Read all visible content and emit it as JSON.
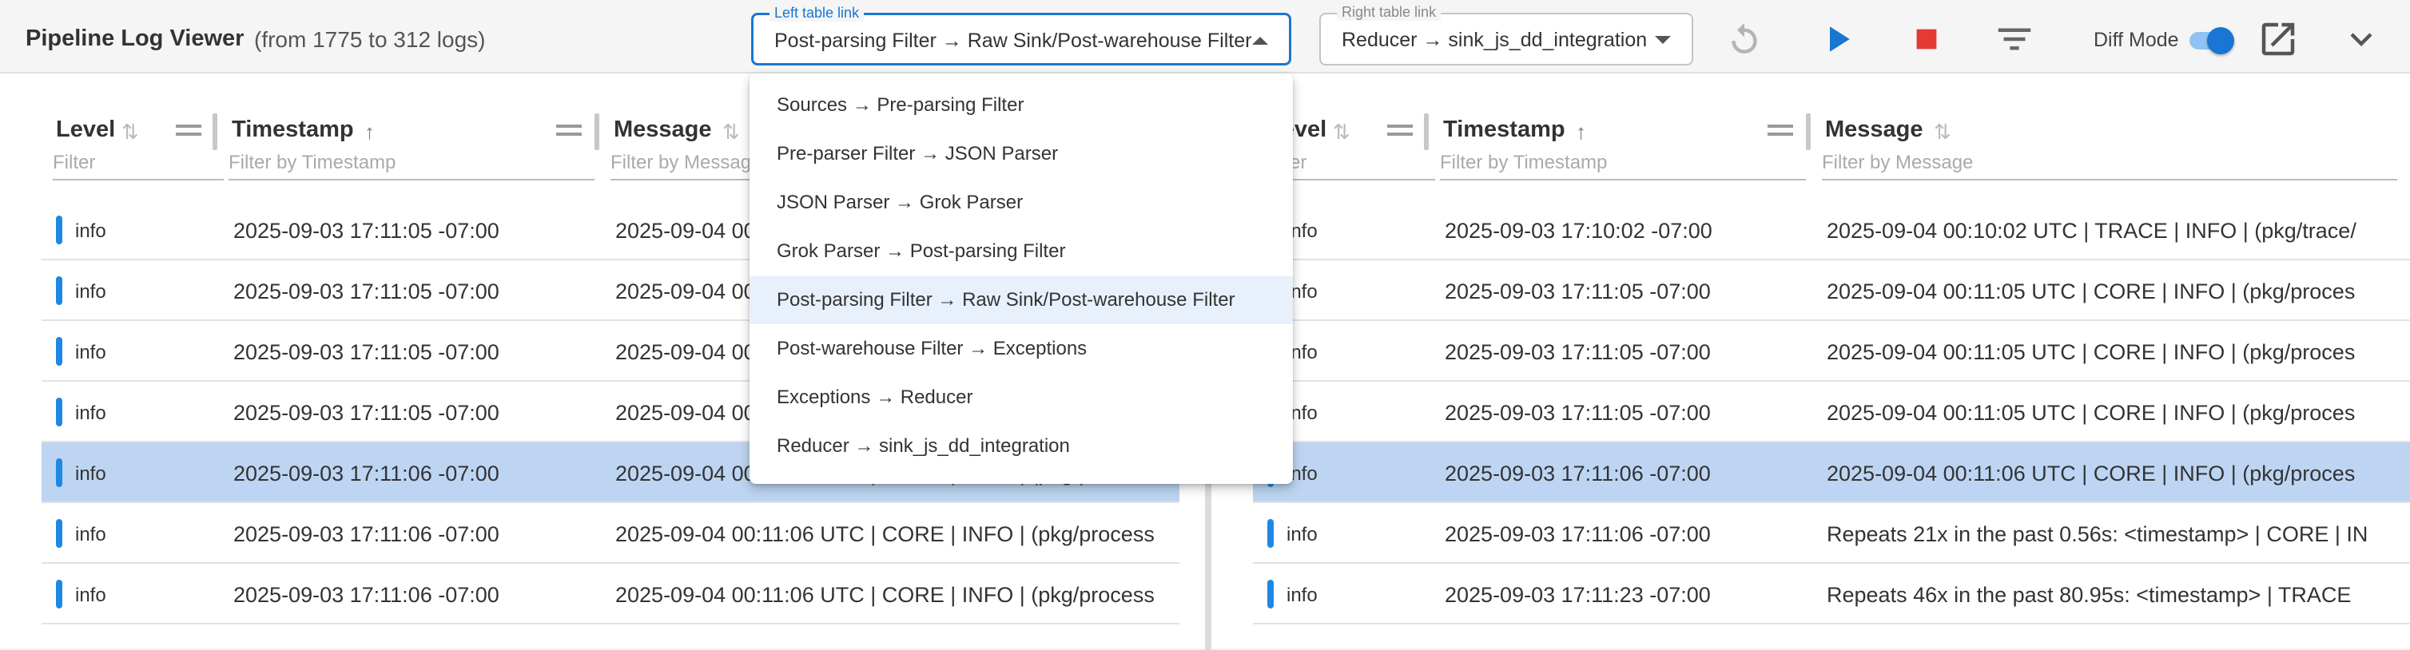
{
  "header": {
    "title": "Pipeline Log Viewer",
    "subtitle": "(from 1775 to 312 logs)",
    "left_select": {
      "legend": "Left table link",
      "value": "Post-parsing Filter → Raw Sink/Post-warehouse Filter"
    },
    "right_select": {
      "legend": "Right table link",
      "value": "Reducer → sink_js_dd_integration"
    },
    "diff_mode_label": "Diff Mode",
    "diff_mode_on": true,
    "icons": [
      "refresh-icon",
      "play-icon",
      "stop-icon",
      "filter-icon",
      "open-external-icon",
      "chevron-down-icon"
    ],
    "colors": {
      "accent": "#1976d2",
      "stop": "#e53935",
      "selected_row": "#bdd5f2",
      "level_bar": "#1e88e5"
    }
  },
  "left_table": {
    "columns": [
      {
        "label": "Level",
        "filter_placeholder": "Filter"
      },
      {
        "label": "Timestamp",
        "filter_placeholder": "Filter by Timestamp"
      },
      {
        "label": "Message",
        "filter_placeholder": "Filter by Message"
      }
    ],
    "rows": [
      {
        "level": "info",
        "timestamp": "2025-09-03 17:11:05 -07:00",
        "message": "2025-09-04 00:11:05 UTC | CORE | INFO | (pkg/process"
      },
      {
        "level": "info",
        "timestamp": "2025-09-03 17:11:05 -07:00",
        "message": "2025-09-04 00:11:05 UTC | CORE | INFO | (pkg/process"
      },
      {
        "level": "info",
        "timestamp": "2025-09-03 17:11:05 -07:00",
        "message": "2025-09-04 00:11:05 UTC | CORE | INFO | (pkg/process"
      },
      {
        "level": "info",
        "timestamp": "2025-09-03 17:11:05 -07:00",
        "message": "2025-09-04 00:11:05 UTC | CORE | INFO | (pkg/process"
      },
      {
        "level": "info",
        "timestamp": "2025-09-03 17:11:06 -07:00",
        "message": "2025-09-04 00:11:06 UTC | CORE | INFO | (pkg/process"
      },
      {
        "level": "info",
        "timestamp": "2025-09-03 17:11:06 -07:00",
        "message": "2025-09-04 00:11:06 UTC | CORE | INFO | (pkg/process"
      },
      {
        "level": "info",
        "timestamp": "2025-09-03 17:11:06 -07:00",
        "message": "2025-09-04 00:11:06 UTC | CORE | INFO | (pkg/process"
      }
    ]
  },
  "right_table": {
    "columns": [
      {
        "label": "Level",
        "filter_placeholder": "Filter"
      },
      {
        "label": "Timestamp",
        "filter_placeholder": "Filter by Timestamp"
      },
      {
        "label": "Message",
        "filter_placeholder": "Filter by Message"
      }
    ],
    "rows": [
      {
        "level": "info",
        "timestamp": "2025-09-03 17:10:02 -07:00",
        "message": "2025-09-04 00:10:02 UTC | TRACE | INFO | (pkg/trace/"
      },
      {
        "level": "info",
        "timestamp": "2025-09-03 17:11:05 -07:00",
        "message": "2025-09-04 00:11:05 UTC | CORE | INFO | (pkg/proces"
      },
      {
        "level": "info",
        "timestamp": "2025-09-03 17:11:05 -07:00",
        "message": "2025-09-04 00:11:05 UTC | CORE | INFO | (pkg/proces"
      },
      {
        "level": "info",
        "timestamp": "2025-09-03 17:11:05 -07:00",
        "message": "2025-09-04 00:11:05 UTC | CORE | INFO | (pkg/proces"
      },
      {
        "level": "info",
        "timestamp": "2025-09-03 17:11:06 -07:00",
        "message": "2025-09-04 00:11:06 UTC | CORE | INFO | (pkg/proces"
      },
      {
        "level": "info",
        "timestamp": "2025-09-03 17:11:06 -07:00",
        "message": "Repeats 21x in the past 0.56s: <timestamp> | CORE | IN"
      },
      {
        "level": "info",
        "timestamp": "2025-09-03 17:11:23 -07:00",
        "message": "Repeats 46x in the past 80.95s: <timestamp> | TRACE"
      }
    ]
  },
  "selected_row_index": 4,
  "dropdown": {
    "selected_index": 4,
    "items": [
      "Sources → Pre-parsing Filter",
      "Pre-parser Filter → JSON Parser",
      "JSON Parser → Grok Parser",
      "Grok Parser → Post-parsing Filter",
      "Post-parsing Filter → Raw Sink/Post-warehouse Filter",
      "Post-warehouse Filter → Exceptions",
      "Exceptions → Reducer",
      "Reducer → sink_js_dd_integration"
    ]
  }
}
